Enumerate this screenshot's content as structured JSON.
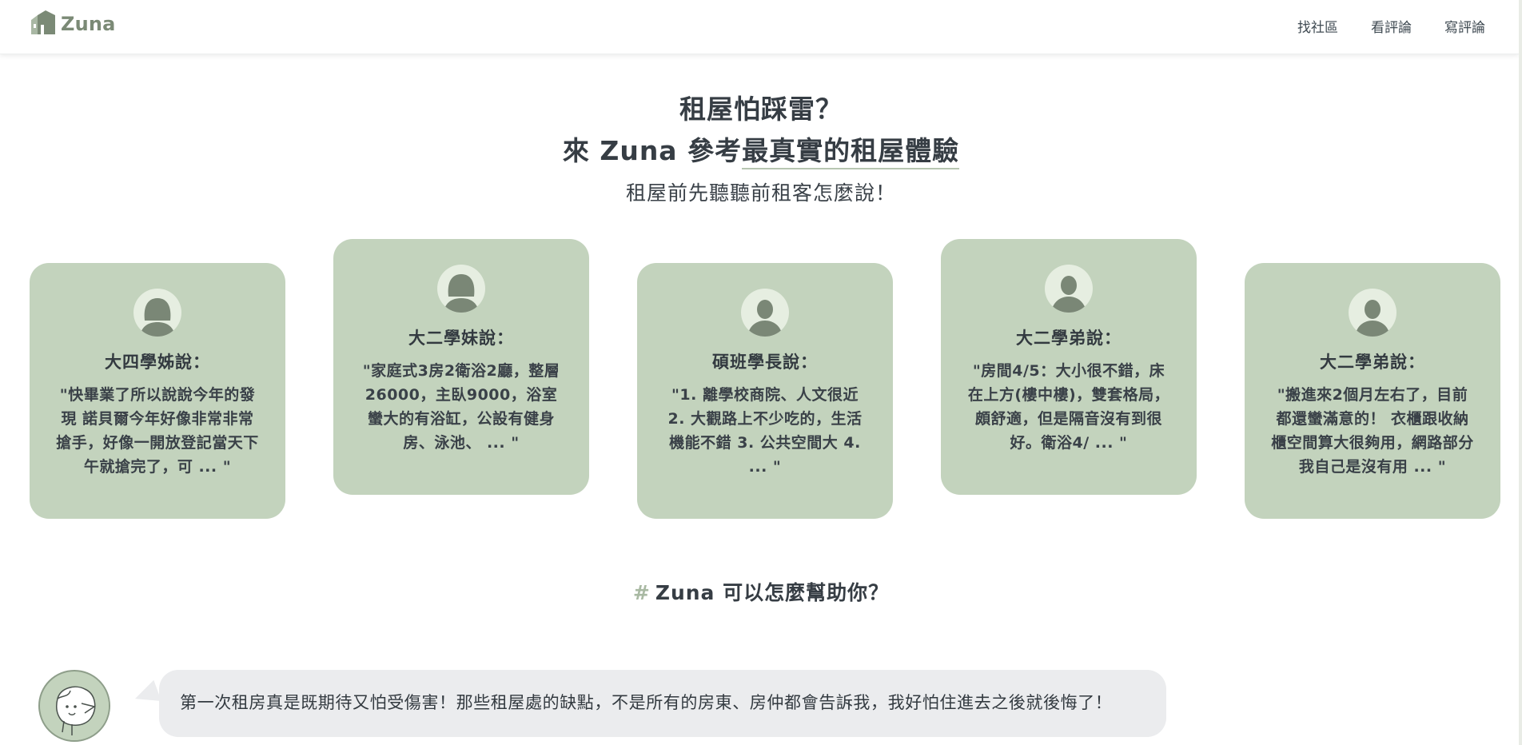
{
  "brand": {
    "name": "Zuna",
    "logo_icon": "house-logo-icon",
    "accent": "#c3d3bd",
    "logo_color": "#7b8a76"
  },
  "nav": {
    "links": [
      {
        "label": "找社區"
      },
      {
        "label": "看評論"
      },
      {
        "label": "寫評論"
      }
    ]
  },
  "hero": {
    "line1": "租屋怕踩雷？",
    "line2_prefix": "來 Zuna 參考",
    "line2_highlight": "最真實的租屋體驗",
    "subtitle": "租屋前先聽聽前租客怎麼說！"
  },
  "reviews": [
    {
      "title": "大四學姊說：",
      "quote": "\"快畢業了所以說說今年的發現 諾貝爾今年好像非常非常搶手，好像一開放登記當天下午就搶完了，可 ... \"",
      "avatar": "female-avatar-icon"
    },
    {
      "title": "大二學妹說：",
      "quote": "\"家庭式3房2衛浴2廳，整層26000，主臥9000，浴室蠻大的有浴缸，公設有健身房、泳池、 ... \"",
      "avatar": "female-avatar-icon"
    },
    {
      "title": "碩班學長說：",
      "quote": "\"1. 離學校商院、人文很近 2. 大觀路上不少吃的，生活機能不錯 3. 公共空間大 4. ... \"",
      "avatar": "male-avatar-icon"
    },
    {
      "title": "大二學弟說：",
      "quote": "\"房間4/5：大小很不錯，床在上方(樓中樓)，雙套格局，頗舒適，但是隔音沒有到很好。衛浴4/ ... \"",
      "avatar": "male-avatar-icon"
    },
    {
      "title": "大二學弟說：",
      "quote": "\"搬進來2個月左右了，目前都還蠻滿意的！ 衣櫃跟收納櫃空間算大很夠用，網路部分我自己是沒有用 ... \"",
      "avatar": "male-avatar-icon"
    }
  ],
  "section": {
    "hash": "#",
    "title": "Zuna 可以怎麼幫助你？"
  },
  "chat": {
    "avatar": "sketch-character-icon",
    "message": "第一次租房真是既期待又怕受傷害！那些租屋處的缺點，不是所有的房東、房仲都會告訴我，我好怕住進去之後就後悔了！"
  }
}
